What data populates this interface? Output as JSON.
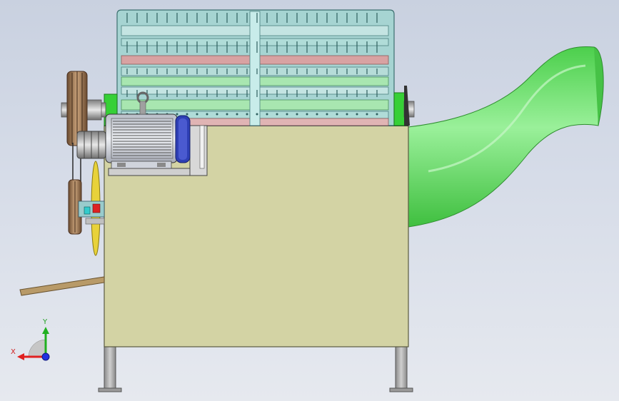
{
  "scene": {
    "view": "front",
    "colors": {
      "background_top": "#c9d1e0",
      "background_bottom": "#e6e9ef",
      "housing": "#d3d3a4",
      "comb_frame": "#9fd0d0",
      "comb_pink": "#d8a2a2",
      "comb_green": "#a8e6b0",
      "outlet_duct": "#5fd65f",
      "motor_body": "#d0d4dc",
      "motor_endcap": "#2e3fb5",
      "bracket_green": "#36d036",
      "pulley": "#a08060",
      "lever": "#b89a68",
      "legs": "#a7a7a7"
    }
  },
  "triad": {
    "x_label": "X",
    "y_label": "Y",
    "x_color": "#e02020",
    "y_color": "#20b020",
    "z_color": "#2030e0"
  }
}
